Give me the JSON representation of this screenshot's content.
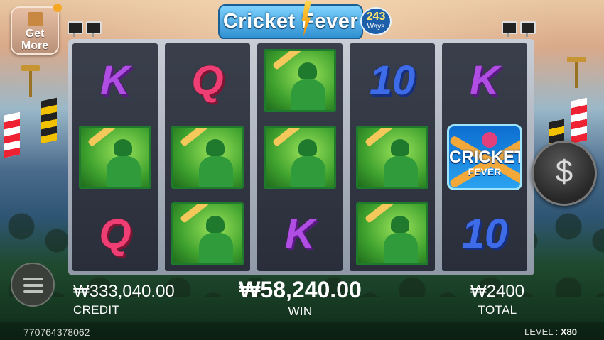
{
  "logo": {
    "title": "Cricket Fever",
    "ways_number": "243",
    "ways_label": "Ways"
  },
  "get_more": {
    "line1": "Get",
    "line2": "More"
  },
  "reels": [
    [
      "K",
      "PLAYER",
      "Q"
    ],
    [
      "Q",
      "PLAYER",
      "PLAYER"
    ],
    [
      "PLAYER",
      "PLAYER",
      "K"
    ],
    [
      "10",
      "PLAYER",
      "PLAYER"
    ],
    [
      "K",
      "WILD",
      "10"
    ]
  ],
  "wild": {
    "line1": "CRICKET",
    "line2": "FEVER"
  },
  "spin_button": {
    "icon": "dollar-icon",
    "symbol": "$"
  },
  "credit": {
    "value": "₩333,040.00",
    "label": "CREDIT"
  },
  "win": {
    "value": "₩58,240.00",
    "label": "WIN"
  },
  "total": {
    "value": "₩2400",
    "label": "TOTAL"
  },
  "footer": {
    "id": "770764378062",
    "level_label": "LEVEL :",
    "level_value": "X80"
  },
  "colors": {
    "K": "#b04ee3",
    "Q": "#ef3e73",
    "10": "#3e6be8",
    "player_bg": "#3fa22e",
    "wild_bg": "#1d7fe0"
  }
}
